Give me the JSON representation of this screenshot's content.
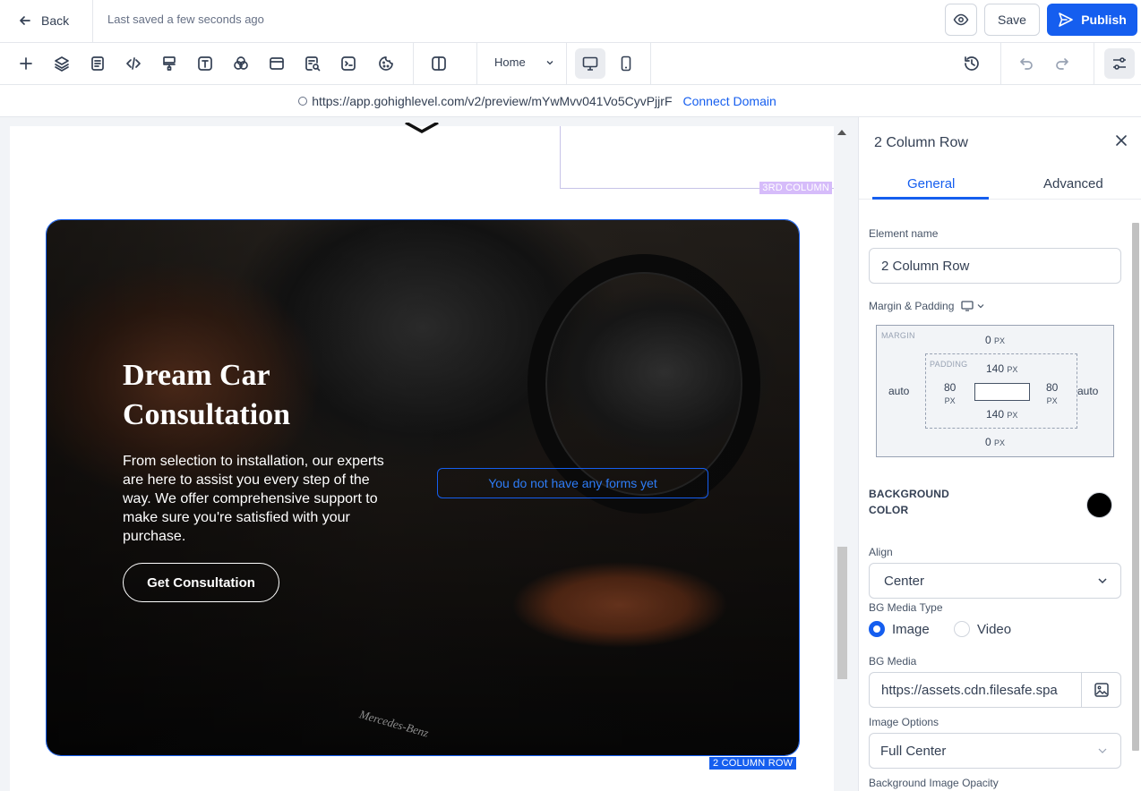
{
  "topbar": {
    "back_label": "Back",
    "saved_status": "Last saved a few seconds ago",
    "save_label": "Save",
    "publish_label": "Publish"
  },
  "toolbar": {
    "page_select": "Home",
    "tools": [
      "add-icon",
      "layers-icon",
      "pages-icon",
      "code-icon",
      "paint-icon",
      "text-icon",
      "blend-icon",
      "layout-icon",
      "form-search-icon",
      "terminal-icon",
      "cookie-icon",
      "split-view-icon"
    ]
  },
  "urlbar": {
    "url": "https://app.gohighlevel.com/v2/preview/mYwMvv041Vo5CyvPjjrF",
    "connect_label": "Connect Domain"
  },
  "canvas": {
    "column_tag": "3RD COLUMN",
    "row_tag": "2 COLUMN ROW",
    "hero": {
      "title_line1": "Dream Car",
      "title_line2": "Consultation",
      "text": "From selection to installation, our experts are here to assist you every step of the way. We offer comprehensive support to make sure you're satisfied with your purchase.",
      "button_label": "Get Consultation",
      "form_placeholder": "You do not have any forms yet",
      "brand_text": "Mercedes-Benz"
    }
  },
  "panel": {
    "title": "2 Column Row",
    "tabs": [
      "General",
      "Advanced"
    ],
    "element_name_label": "Element name",
    "element_name_value": "2 Column Row",
    "margin_padding_label": "Margin & Padding",
    "box": {
      "margin_label": "MARGIN",
      "padding_label": "PADDING",
      "margin_top": "0",
      "margin_bottom": "0",
      "margin_left": "auto",
      "margin_right": "auto",
      "padding_top": "140",
      "padding_bottom": "140",
      "padding_left": "80",
      "padding_right": "80",
      "unit": "PX"
    },
    "background_color_label_1": "BACKGROUND",
    "background_color_label_2": "COLOR",
    "background_color": "#000000",
    "align_label": "Align",
    "align_value": "Center",
    "bg_media_type_label": "BG Media Type",
    "media_types": [
      "Image",
      "Video"
    ],
    "media_type_selected": "Image",
    "bg_media_label": "BG Media",
    "bg_media_value": "https://assets.cdn.filesafe.spa",
    "image_options_label": "Image Options",
    "image_options_value": "Full Center",
    "bg_opacity_label": "Background Image Opacity"
  },
  "colors": {
    "accent": "#155eef",
    "column_tag": "#d6bcfa"
  }
}
